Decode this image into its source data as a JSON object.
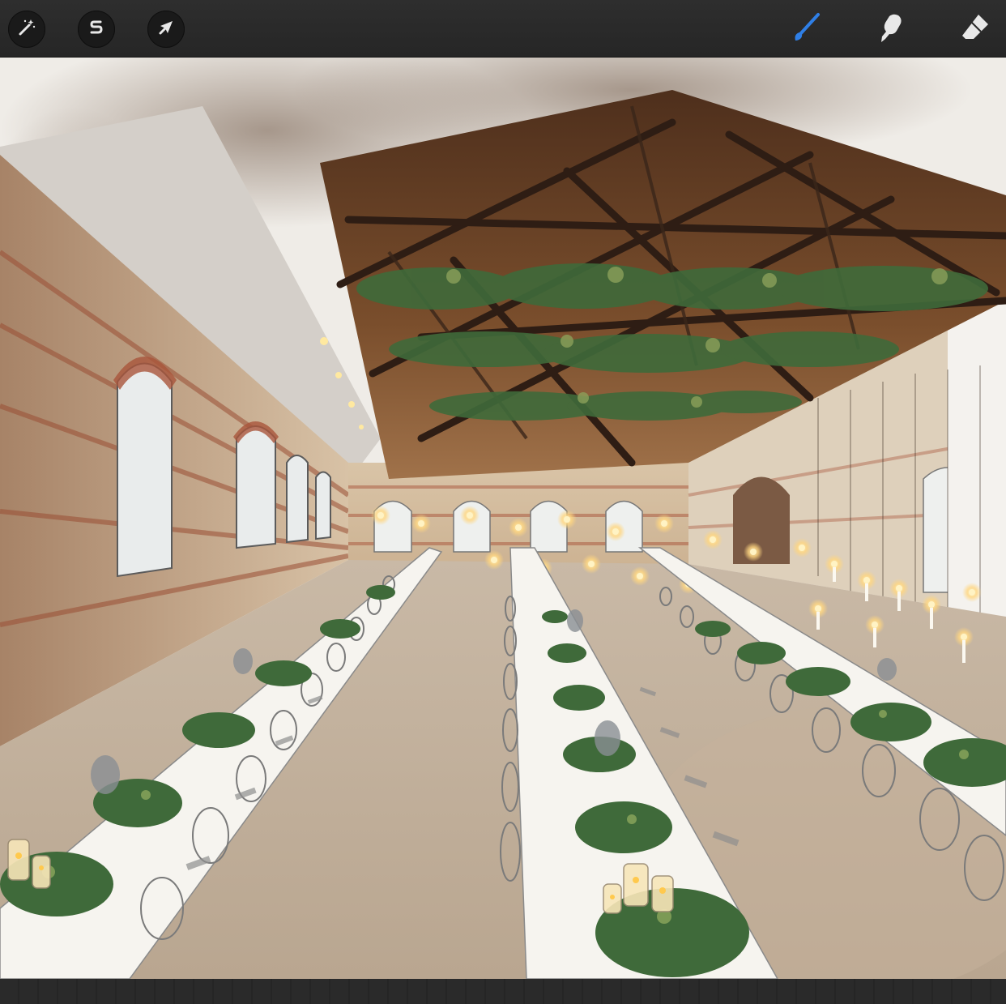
{
  "toolbar": {
    "left_tools": [
      {
        "name": "adjustments",
        "icon": "magic-wand-icon"
      },
      {
        "name": "selection",
        "icon": "selection-s-icon"
      },
      {
        "name": "transform",
        "icon": "arrow-cursor-icon"
      }
    ],
    "right_tools": [
      {
        "name": "brush",
        "icon": "brush-icon",
        "active": true
      },
      {
        "name": "smudge",
        "icon": "smudge-finger-icon",
        "active": false
      },
      {
        "name": "eraser",
        "icon": "eraser-icon",
        "active": false
      }
    ],
    "colors": {
      "bar": "#2a2a2a",
      "icon": "#e8e8e8",
      "active": "#2f7fe6"
    }
  },
  "canvas": {
    "content": "watercolor-interior-sketch",
    "colors": {
      "paper": "#efece7",
      "brick": "#b08a6e",
      "ceiling": "#6a4428",
      "greenery": "#3f6a3a",
      "candle": "#ffd680"
    }
  }
}
